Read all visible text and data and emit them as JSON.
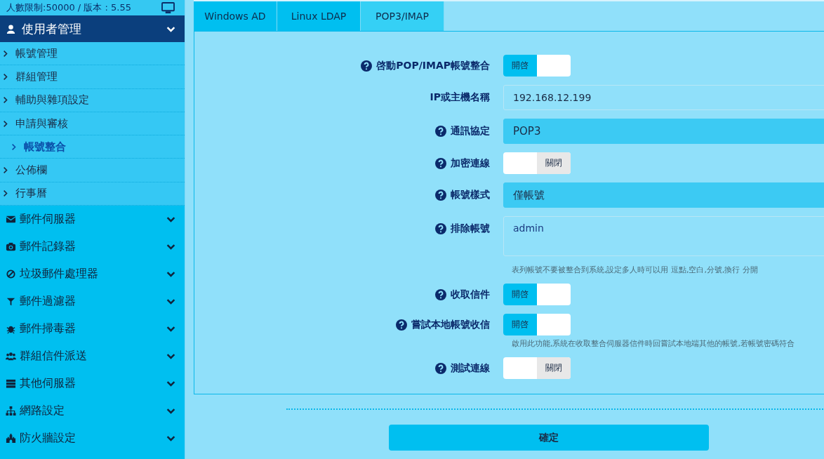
{
  "sidebar": {
    "header": {
      "text": "人數限制:50000 / 版本 : 5.55"
    },
    "section": {
      "title": "使用者管理",
      "expanded": true,
      "items": [
        {
          "label": "帳號管理",
          "selected": false
        },
        {
          "label": "群組管理",
          "selected": false
        },
        {
          "label": "輔助與雜項設定",
          "selected": false
        },
        {
          "label": "申請與審核",
          "selected": false
        },
        {
          "label": "帳號整合",
          "selected": true
        },
        {
          "label": "公佈欄",
          "selected": false
        },
        {
          "label": "行事曆",
          "selected": false
        }
      ]
    },
    "menu": [
      {
        "label": "郵件伺服器",
        "expanded": false
      },
      {
        "label": "郵件記錄器",
        "expanded": false
      },
      {
        "label": "垃圾郵件處理器",
        "expanded": false
      },
      {
        "label": "郵件過濾器",
        "expanded": false
      },
      {
        "label": "郵件掃毒器",
        "expanded": false
      },
      {
        "label": "群組信件派送",
        "expanded": false
      },
      {
        "label": "其他伺服器",
        "expanded": false
      },
      {
        "label": "網路設定",
        "expanded": false
      },
      {
        "label": "防火牆設定",
        "expanded": false
      }
    ]
  },
  "tabs": [
    {
      "label": "Windows AD",
      "selected": false
    },
    {
      "label": "Linux LDAP",
      "selected": false
    },
    {
      "label": "POP3/IMAP",
      "selected": true
    }
  ],
  "form": [
    {
      "kind": "toggle",
      "label": "啓動POP/IMAP帳號整合",
      "help": true,
      "on": true,
      "state_text": "開啓"
    },
    {
      "kind": "text",
      "label": "IP或主機名稱",
      "help": false,
      "value": "192.168.12.199"
    },
    {
      "kind": "select",
      "label": "通訊協定",
      "help": true,
      "value": "POP3"
    },
    {
      "kind": "toggle",
      "label": "加密連線",
      "help": true,
      "on": false,
      "state_text": "關閉"
    },
    {
      "kind": "select",
      "label": "帳號樣式",
      "help": true,
      "value": "僅帳號"
    },
    {
      "kind": "textarea",
      "label": "排除帳號",
      "help": true,
      "value": "admin",
      "hint": "表列帳號不要被整合到系統,設定多人時可以用 逗點,空白,分號,換行 分開"
    },
    {
      "kind": "toggle",
      "label": "收取信件",
      "help": true,
      "on": true,
      "state_text": "開啓"
    },
    {
      "kind": "toggle",
      "label": "嘗試本地帳號收信",
      "help": true,
      "on": true,
      "state_text": "開啓",
      "hint": "啟用此功能,系統在收取整合伺服器信件時回嘗試本地端其他的帳號,若帳號密碼符合"
    },
    {
      "kind": "toggle",
      "label": "測試連線",
      "help": true,
      "on": false,
      "state_text": "關閉"
    }
  ],
  "submit": {
    "label": "確定"
  }
}
